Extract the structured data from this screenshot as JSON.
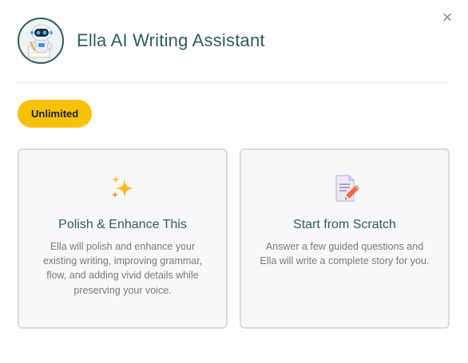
{
  "modal": {
    "title": "Ella AI Writing Assistant",
    "close_label": "×",
    "avatar_icon": "robot-avatar-icon"
  },
  "badge": {
    "label": "Unlimited",
    "color": "#f7c206"
  },
  "options": [
    {
      "icon": "sparkles-icon",
      "title": "Polish & Enhance This",
      "description": "Ella will polish and enhance your existing writing, improving grammar, flow, and adding vivid details while preserving your voice."
    },
    {
      "icon": "document-pencil-icon",
      "title": "Start from Scratch",
      "description": "Answer a few guided questions and Ella will write a complete story for you."
    }
  ],
  "colors": {
    "accent": "#2f5d5a",
    "card_background": "#f7f8fa",
    "card_border": "#dcdcdc",
    "muted_text": "#7a7a7a"
  }
}
